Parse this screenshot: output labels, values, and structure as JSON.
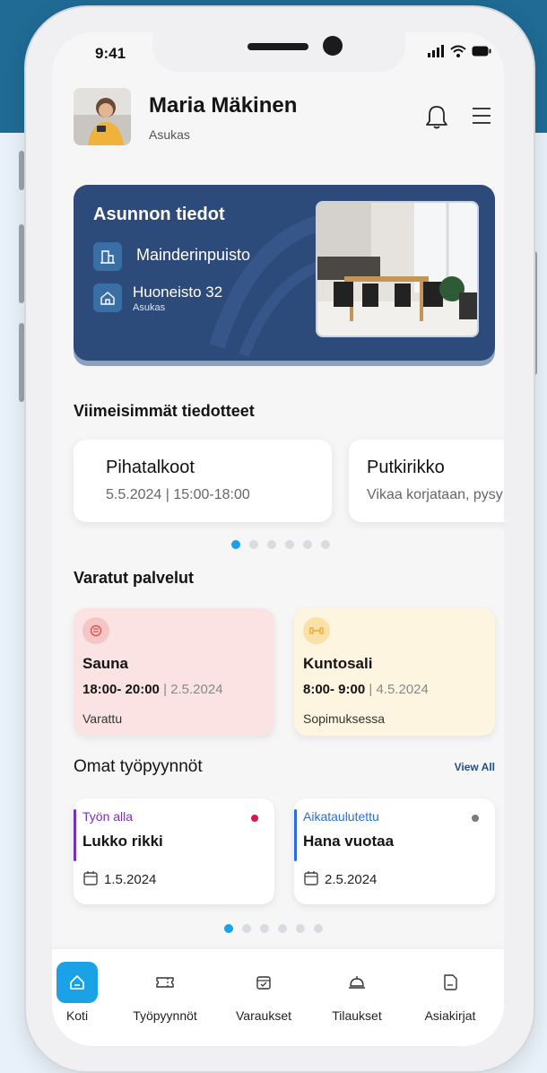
{
  "status_bar": {
    "time": "9:41"
  },
  "user": {
    "name": "Maria Mäkinen",
    "role": "Asukas"
  },
  "apartment": {
    "title": "Asunnon tiedot",
    "property": "Mainderinpuisto",
    "unit": "Huoneisto 32",
    "unit_role": "Asukas"
  },
  "bulletins": {
    "title": "Viimeisimmät tiedotteet",
    "items": [
      {
        "title": "Pihatalkoot",
        "subtitle": "5.5.2024 | 15:00-18:00"
      },
      {
        "title": "Putkirikko",
        "subtitle": "Vikaa korjataan, pysy"
      }
    ]
  },
  "services": {
    "title": "Varatut palvelut",
    "items": [
      {
        "title": "Sauna",
        "time": "18:00- 20:00",
        "date": "| 2.5.2024",
        "status": "Varattu",
        "bg": "#fbe3e3",
        "icon_bg": "#f5c6c6",
        "icon_color": "#d9534f"
      },
      {
        "title": "Kuntosali",
        "time": "8:00- 9:00",
        "date": "| 4.5.2024",
        "status": "Sopimuksessa",
        "bg": "#fef5e1",
        "icon_bg": "#fbe1a8",
        "icon_color": "#e8a82a"
      }
    ]
  },
  "work_orders": {
    "title": "Omat työpyynnöt",
    "view_all": "View All",
    "items": [
      {
        "status": "Työn alla",
        "title": "Lukko rikki",
        "date": "1.5.2024",
        "color": "#7b2fbe",
        "dot": "#e0124f"
      },
      {
        "status": "Aikataulutettu",
        "title": "Hana vuotaa",
        "date": "2.5.2024",
        "color": "#2a6fd6",
        "dot": "#7a7a7a"
      }
    ]
  },
  "nav": {
    "items": [
      {
        "label": "Koti",
        "icon": "home-icon"
      },
      {
        "label": "Työpyynnöt",
        "icon": "ticket-icon"
      },
      {
        "label": "Varaukset",
        "icon": "calendar-icon"
      },
      {
        "label": "Tilaukset",
        "icon": "bell-service-icon"
      },
      {
        "label": "Asiakirjat",
        "icon": "document-icon"
      }
    ]
  },
  "colors": {
    "accent": "#1ba1e6",
    "card": "#2c4a7a",
    "band": "#1f6b95"
  }
}
